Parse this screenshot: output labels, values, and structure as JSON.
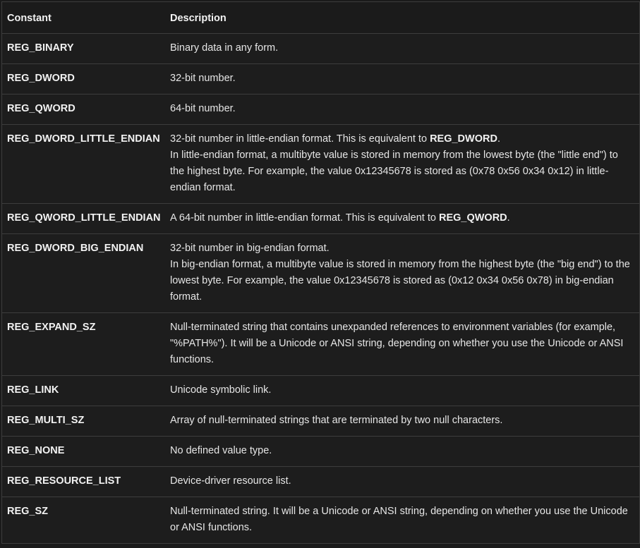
{
  "table": {
    "headers": {
      "constant": "Constant",
      "description": "Description"
    },
    "rows": [
      {
        "constant": "REG_BINARY",
        "desc_1": "Binary data in any form."
      },
      {
        "constant": "REG_DWORD",
        "desc_1": "32-bit number."
      },
      {
        "constant": "REG_QWORD",
        "desc_1": "64-bit number."
      },
      {
        "constant": "REG_DWORD_LITTLE_ENDIAN",
        "desc_1": "32-bit number in little-endian format. This is equivalent to ",
        "desc_bold": "REG_DWORD",
        "desc_1_end": ".",
        "desc_2": "In little-endian format, a multibyte value is stored in memory from the lowest byte (the \"little end\") to the highest byte. For example, the value 0x12345678 is stored as (0x78 0x56 0x34 0x12) in little-endian format."
      },
      {
        "constant": "REG_QWORD_LITTLE_ENDIAN",
        "desc_1": "A 64-bit number in little-endian format. This is equivalent to ",
        "desc_bold": "REG_QWORD",
        "desc_1_end": "."
      },
      {
        "constant": "REG_DWORD_BIG_ENDIAN",
        "desc_1": "32-bit number in big-endian format.",
        "desc_2": "In big-endian format, a multibyte value is stored in memory from the highest byte (the \"big end\") to the lowest byte. For example, the value 0x12345678 is stored as (0x12 0x34 0x56 0x78) in big-endian format."
      },
      {
        "constant": "REG_EXPAND_SZ",
        "desc_1": "Null-terminated string that contains unexpanded references to environment variables (for example, \"%PATH%\"). It will be a Unicode or ANSI string, depending on whether you use the Unicode or ANSI functions."
      },
      {
        "constant": "REG_LINK",
        "desc_1": "Unicode symbolic link."
      },
      {
        "constant": "REG_MULTI_SZ",
        "desc_1": "Array of null-terminated strings that are terminated by two null characters."
      },
      {
        "constant": "REG_NONE",
        "desc_1": "No defined value type."
      },
      {
        "constant": "REG_RESOURCE_LIST",
        "desc_1": "Device-driver resource list."
      },
      {
        "constant": "REG_SZ",
        "desc_1": "Null-terminated string. It will be a Unicode or ANSI string, depending on whether you use the Unicode or ANSI functions."
      }
    ]
  }
}
